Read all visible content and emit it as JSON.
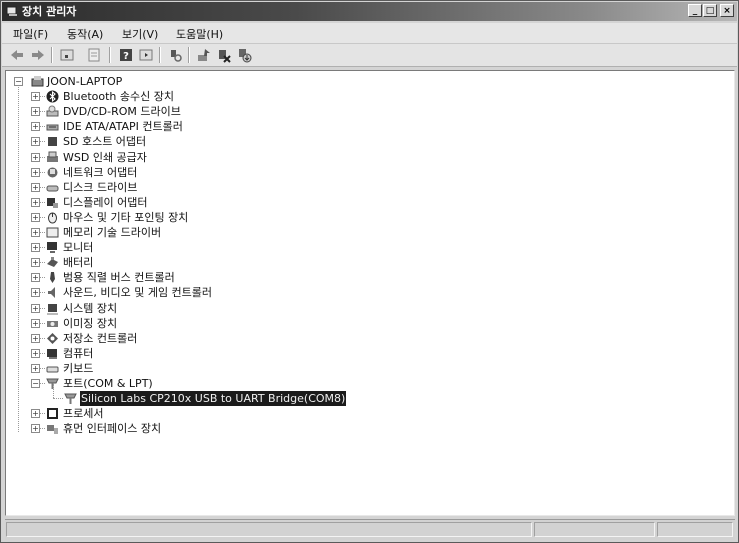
{
  "window": {
    "title": "장치 관리자",
    "buttons": {
      "minimize": "_",
      "maximize": "□",
      "close": "×"
    }
  },
  "menubar": {
    "items": [
      {
        "label": "파일(F)"
      },
      {
        "label": "동작(A)"
      },
      {
        "label": "보기(V)"
      },
      {
        "label": "도움말(H)"
      }
    ]
  },
  "toolbar": {
    "buttons": [
      {
        "icon": "back-arrow-icon"
      },
      {
        "icon": "forward-arrow-icon"
      },
      {
        "icon": "show-hide-console-tree-icon"
      },
      {
        "icon": "properties-icon"
      },
      {
        "icon": "help-icon"
      },
      {
        "icon": "action-pane-icon"
      },
      {
        "icon": "scan-hardware-icon"
      },
      {
        "icon": "update-driver-icon"
      },
      {
        "icon": "disable-device-icon"
      },
      {
        "icon": "uninstall-device-icon"
      }
    ]
  },
  "tree": {
    "root": {
      "label": "JOON-LAPTOP",
      "icon": "computer-icon",
      "expanded": true
    },
    "categories": [
      {
        "label": "Bluetooth 송수신 장치",
        "icon": "bluetooth-icon",
        "expanded": false
      },
      {
        "label": "DVD/CD-ROM 드라이브",
        "icon": "dvd-drive-icon",
        "expanded": false
      },
      {
        "label": "IDE ATA/ATAPI 컨트롤러",
        "icon": "ide-controller-icon",
        "expanded": false
      },
      {
        "label": "SD 호스트 어댑터",
        "icon": "sd-host-icon",
        "expanded": false
      },
      {
        "label": "WSD 인쇄 공급자",
        "icon": "printer-icon",
        "expanded": false
      },
      {
        "label": "네트워크 어댑터",
        "icon": "network-adapter-icon",
        "expanded": false
      },
      {
        "label": "디스크 드라이브",
        "icon": "disk-drive-icon",
        "expanded": false
      },
      {
        "label": "디스플레이 어댑터",
        "icon": "display-adapter-icon",
        "expanded": false
      },
      {
        "label": "마우스 및 기타 포인팅 장치",
        "icon": "mouse-icon",
        "expanded": false
      },
      {
        "label": "메모리 기술 드라이버",
        "icon": "memory-icon",
        "expanded": false
      },
      {
        "label": "모니터",
        "icon": "monitor-icon",
        "expanded": false
      },
      {
        "label": "배터리",
        "icon": "battery-icon",
        "expanded": false
      },
      {
        "label": "범용 직렬 버스 컨트롤러",
        "icon": "usb-icon",
        "expanded": false
      },
      {
        "label": "사운드, 비디오 및 게임 컨트롤러",
        "icon": "speaker-icon",
        "expanded": false
      },
      {
        "label": "시스템 장치",
        "icon": "system-device-icon",
        "expanded": false
      },
      {
        "label": "이미징 장치",
        "icon": "camera-icon",
        "expanded": false
      },
      {
        "label": "저장소 컨트롤러",
        "icon": "storage-controller-icon",
        "expanded": false
      },
      {
        "label": "컴퓨터",
        "icon": "computer-category-icon",
        "expanded": false
      },
      {
        "label": "키보드",
        "icon": "keyboard-icon",
        "expanded": false
      },
      {
        "label": "포트(COM & LPT)",
        "icon": "port-icon",
        "expanded": true,
        "children": [
          {
            "label": "Silicon Labs CP210x USB to UART Bridge(COM8)",
            "icon": "port-icon",
            "selected": true
          }
        ]
      },
      {
        "label": "프로세서",
        "icon": "processor-icon",
        "expanded": false
      },
      {
        "label": "휴먼 인터페이스 장치",
        "icon": "hid-icon",
        "expanded": false
      }
    ]
  },
  "statusbar": {
    "panes": [
      "",
      "",
      ""
    ]
  },
  "colors": {
    "selection_bg": "#1b1b1b",
    "selection_fg": "#f0f0f0",
    "titlebar_dark": "#2c2c2c"
  }
}
